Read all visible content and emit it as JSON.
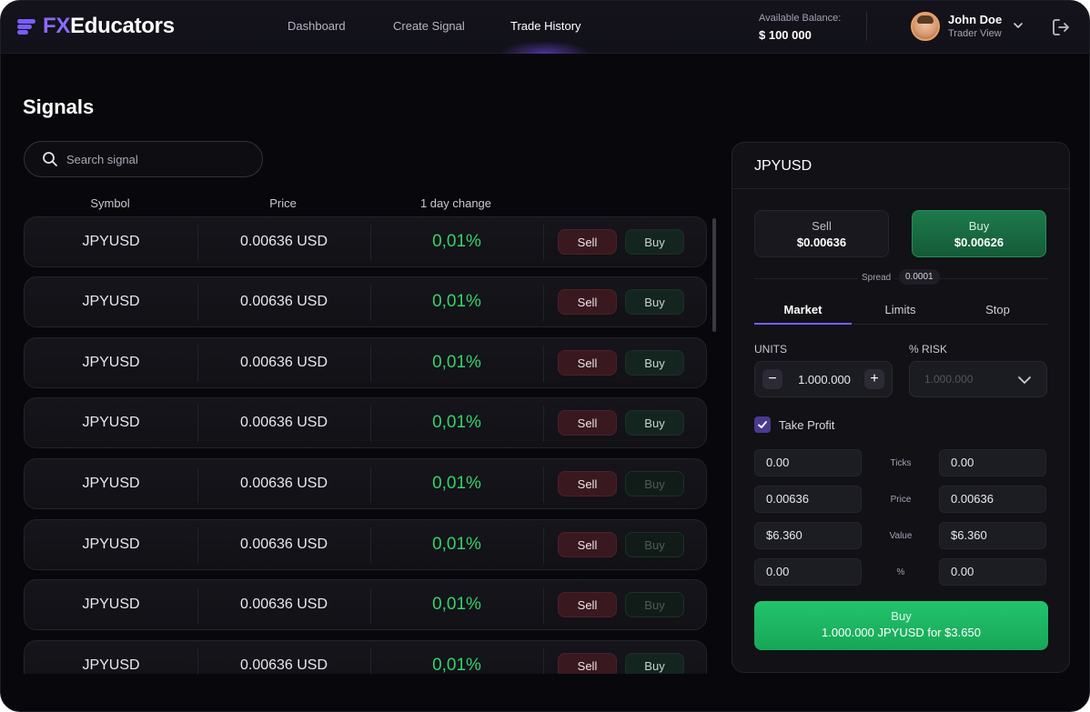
{
  "brand": {
    "prefix": "FX",
    "name": "Educators"
  },
  "nav": [
    {
      "label": "Dashboard"
    },
    {
      "label": "Create Signal"
    },
    {
      "label": "Trade History"
    }
  ],
  "balance": {
    "label": "Available Balance:",
    "value": "$ 100 000"
  },
  "user": {
    "name": "John Doe",
    "role": "Trader View"
  },
  "page": {
    "title": "Signals"
  },
  "search": {
    "placeholder": "Search signal"
  },
  "table": {
    "columns": [
      "Symbol",
      "Price",
      "1 day change"
    ],
    "sell_label": "Sell",
    "buy_label": "Buy",
    "rows": [
      {
        "symbol": "JPYUSD",
        "price": "0.00636 USD",
        "change": "0,01%"
      },
      {
        "symbol": "JPYUSD",
        "price": "0.00636 USD",
        "change": "0,01%"
      },
      {
        "symbol": "JPYUSD",
        "price": "0.00636 USD",
        "change": "0,01%"
      },
      {
        "symbol": "JPYUSD",
        "price": "0.00636 USD",
        "change": "0,01%"
      },
      {
        "symbol": "JPYUSD",
        "price": "0.00636 USD",
        "change": "0,01%"
      },
      {
        "symbol": "JPYUSD",
        "price": "0.00636 USD",
        "change": "0,01%"
      },
      {
        "symbol": "JPYUSD",
        "price": "0.00636 USD",
        "change": "0,01%"
      },
      {
        "symbol": "JPYUSD",
        "price": "0.00636 USD",
        "change": "0,01%"
      }
    ]
  },
  "order": {
    "symbol": "JPYUSD",
    "sell": {
      "label": "Sell",
      "price": "$0.00636"
    },
    "buy": {
      "label": "Buy",
      "price": "$0.00626"
    },
    "spread": {
      "label": "Spread",
      "value": "0.0001"
    },
    "tabs": [
      "Market",
      "Limits",
      "Stop"
    ],
    "units": {
      "label": "UNITS",
      "value": "1.000.000",
      "minus": "−",
      "plus": "+"
    },
    "risk": {
      "label": "% RISK",
      "value": "1.000.000"
    },
    "take_profit": {
      "label": "Take Profit",
      "checked": true
    },
    "tp_rows": [
      {
        "left": "0.00",
        "label": "Ticks",
        "right": "0.00"
      },
      {
        "left": "0.00636",
        "label": "Price",
        "right": "0.00636"
      },
      {
        "left": "$6.360",
        "label": "Value",
        "right": "$6.360"
      },
      {
        "left": "0.00",
        "label": "%",
        "right": "0.00"
      }
    ],
    "cta": {
      "line1": "Buy",
      "line2": "1.000.000 JPYUSD for $3.650"
    }
  },
  "colors": {
    "accent": "#7b5cff",
    "positive": "#34d36a",
    "sell": "#3a1820",
    "buy_cta": "#22c46c"
  }
}
